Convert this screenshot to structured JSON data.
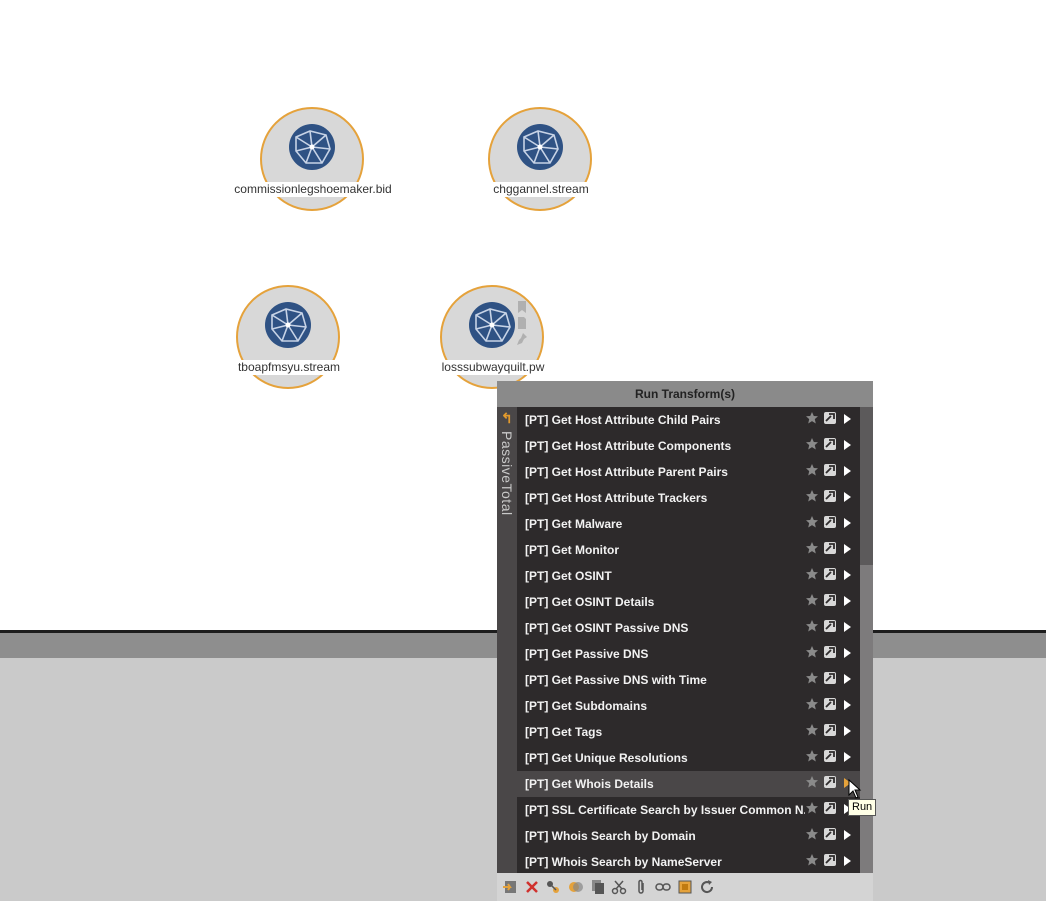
{
  "graph": {
    "nodes": [
      {
        "label": "commissionlegshoemaker.bid",
        "icon": "globe-icon"
      },
      {
        "label": "chggannel.stream",
        "icon": "globe-icon"
      },
      {
        "label": "tboapfmsyu.stream",
        "icon": "globe-icon"
      },
      {
        "label": "losssubwayquilt.pw",
        "icon": "globe-icon"
      }
    ],
    "node_border_color": "#e5a23b",
    "globe_color": "#2f5284"
  },
  "transform_panel": {
    "title": "Run Transform(s)",
    "category_tab": "PassiveTotal",
    "items": [
      {
        "label": "[PT] Get Host Attribute Child Pairs"
      },
      {
        "label": "[PT] Get Host Attribute Components"
      },
      {
        "label": "[PT] Get Host Attribute Parent Pairs"
      },
      {
        "label": "[PT] Get Host Attribute Trackers"
      },
      {
        "label": "[PT] Get Malware"
      },
      {
        "label": "[PT] Get Monitor"
      },
      {
        "label": "[PT] Get OSINT"
      },
      {
        "label": "[PT] Get OSINT Details"
      },
      {
        "label": "[PT] Get OSINT Passive DNS"
      },
      {
        "label": "[PT] Get Passive DNS"
      },
      {
        "label": "[PT] Get Passive DNS with Time"
      },
      {
        "label": "[PT] Get Subdomains"
      },
      {
        "label": "[PT] Get Tags"
      },
      {
        "label": "[PT] Get Unique Resolutions"
      },
      {
        "label": "[PT] Get Whois Details",
        "hovered": true
      },
      {
        "label": "[PT] SSL Certificate Search by Issuer Common N..."
      },
      {
        "label": "[PT] Whois Search by Domain"
      },
      {
        "label": "[PT] Whois Search by NameServer"
      }
    ],
    "accent_color": "#e5a23b"
  },
  "tooltip": {
    "text": "Run"
  },
  "toolbar": {
    "icons": [
      "import-icon",
      "delete-icon",
      "transform-icon",
      "merge-icon",
      "copy-icon",
      "cut-icon",
      "attach-icon",
      "link-icon",
      "select-icon",
      "refresh-icon"
    ]
  }
}
